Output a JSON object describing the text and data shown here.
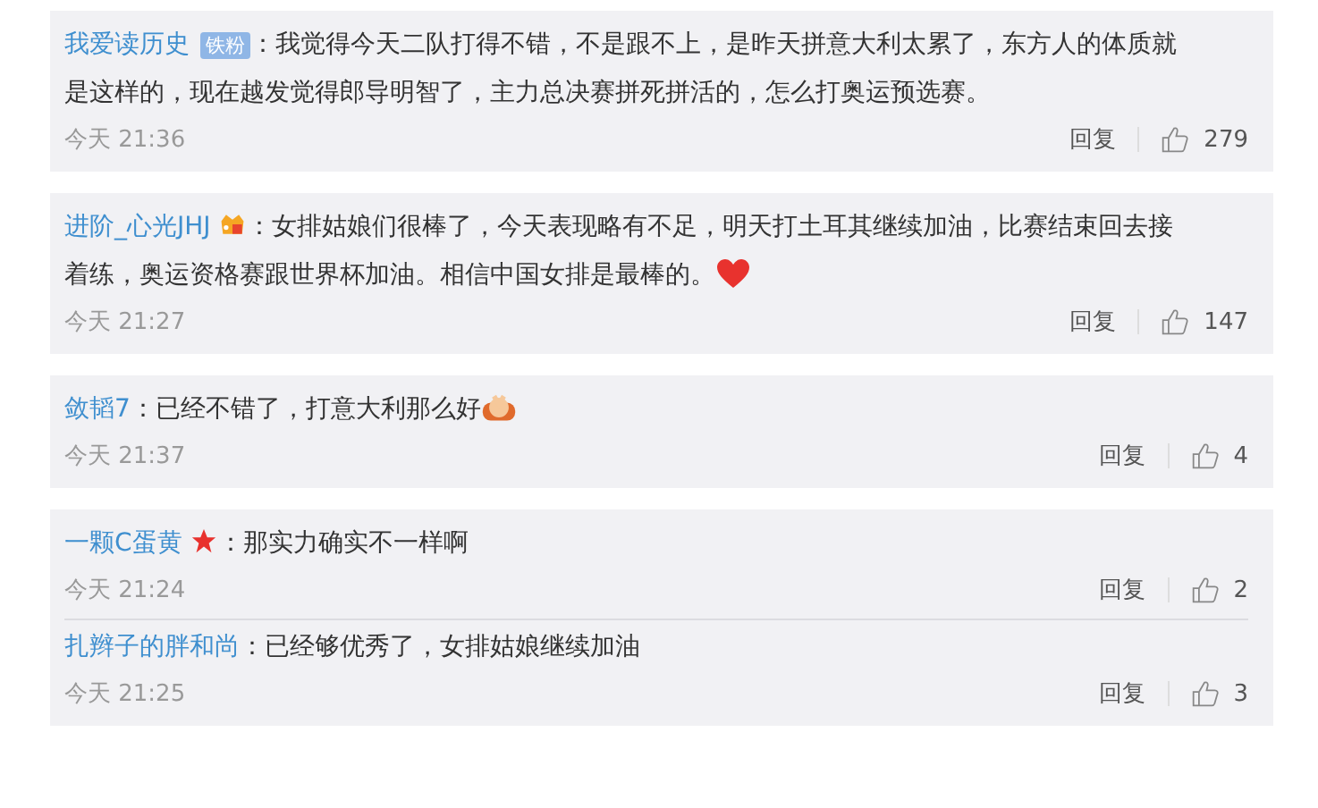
{
  "cards": [
    {
      "comments": [
        {
          "user": "我爱读历史",
          "badge": "铁粉",
          "text": "：我觉得今天二队打得不错，不是跟不上，是昨天拼意大利太累了，东方人的体质就是这样的，现在越发觉得郎导明智了，主力总决赛拼死拼活的，怎么打奥运预选赛。",
          "time": "今天 21:36",
          "reply": "回复",
          "likes": "279"
        }
      ]
    },
    {
      "comments": [
        {
          "user": "进阶_心光JHJ",
          "user_icon": {
            "kind": "crown"
          },
          "text": "：女排姑娘们很棒了，今天表现略有不足，明天打土耳其继续加油，比赛结束回去接着练，奥运资格赛跟世界杯加油。相信中国女排是最棒的。",
          "emoji": {
            "kind": "heart"
          },
          "time": "今天 21:27",
          "reply": "回复",
          "likes": "147"
        }
      ]
    },
    {
      "comments": [
        {
          "user": "敛韬7",
          "text": "：已经不错了，打意大利那么好",
          "emoji": {
            "kind": "hands"
          },
          "time": "今天 21:37",
          "reply": "回复",
          "likes": "4"
        }
      ]
    },
    {
      "comments": [
        {
          "user": "一颗C蛋黄",
          "user_icon": {
            "kind": "star"
          },
          "text": "：那实力确实不一样啊",
          "time": "今天 21:24",
          "reply": "回复",
          "likes": "2"
        },
        {
          "user": "扎辫子的胖和尚",
          "text": "：已经够优秀了，女排姑娘继续加油",
          "time": "今天 21:25",
          "reply": "回复",
          "likes": "3"
        }
      ]
    }
  ]
}
